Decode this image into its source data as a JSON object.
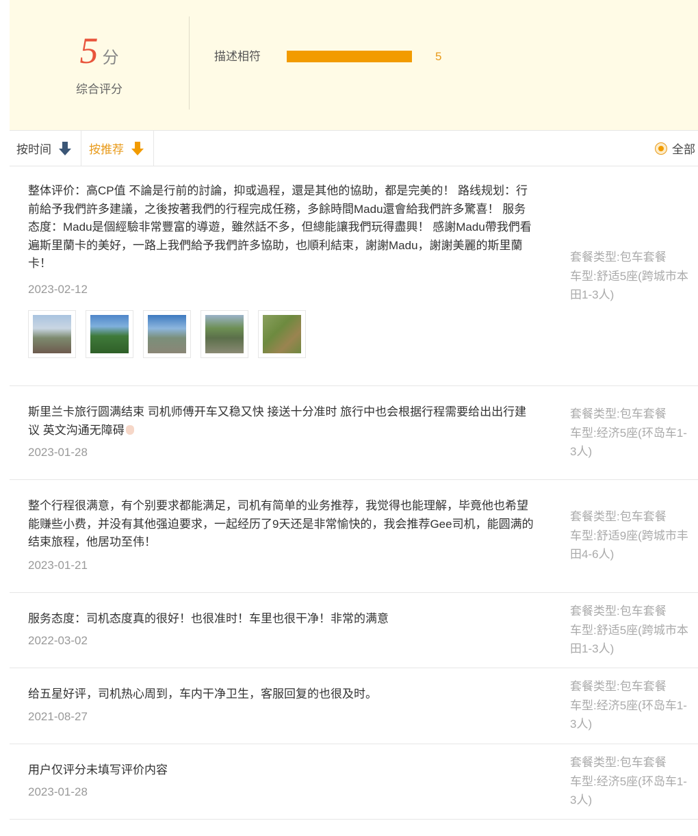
{
  "summary": {
    "score": "5",
    "score_unit": "分",
    "score_label": "综合评分",
    "metric": {
      "label": "描述相符",
      "value": "5",
      "fill_fraction": 1.0
    }
  },
  "sort": {
    "by_time": "按时间",
    "by_recommend": "按推荐",
    "filter_all": "全部",
    "active": "by_recommend"
  },
  "colors": {
    "accent": "#f29b00",
    "score": "#e8543c",
    "summary_bg": "#fffbe6",
    "arrow_dark": "#3b5676"
  },
  "reviews": [
    {
      "text": "整体评价：高CP值 不論是行前的討論，抑或過程，還是其他的協助，都是完美的！ 路线规划：行前給予我們許多建議，之後按著我們的行程完成任務，多餘時間Madu還會給我們許多驚喜！ 服务态度：Madu是個經驗非常豐富的導遊，雖然話不多，但總能讓我們玩得盡興！ 感謝Madu帶我們看遍斯里蘭卡的美好，一路上我們給予我們許多協助，也順利結束，謝謝Madu，謝謝美麗的斯里蘭卡！",
      "date": "2023-02-12",
      "meta_package": "套餐类型:包车套餐",
      "meta_car": "车型:舒适5座(跨城市本田1-3人)",
      "photos": [
        "photo-cliff-icon",
        "photo-trees-icon",
        "photo-valley-icon",
        "photo-rock-icon",
        "photo-grass-icon"
      ]
    },
    {
      "text": "斯里兰卡旅行圆满结束 司机师傅开车又稳又快 接送十分准时 旅行中也会根据行程需要给出出行建议 英文沟通无障碍",
      "date": "2023-01-28",
      "meta_package": "套餐类型:包车套餐",
      "meta_car": "车型:经济5座(环岛车1-3人)",
      "emoji": "ok-hand-emoji-icon"
    },
    {
      "text": "整个行程很满意，有个别要求都能满足，司机有简单的业务推荐，我觉得也能理解，毕竟他也希望能赚些小费，并没有其他强迫要求，一起经历了9天还是非常愉快的，我会推荐Gee司机，能圆满的结束旅程，他居功至伟！",
      "date": "2023-01-21",
      "meta_package": "套餐类型:包车套餐",
      "meta_car": "车型:舒适9座(跨城市丰田4-6人)"
    },
    {
      "text": "服务态度：司机态度真的很好！也很准时！车里也很干净！非常的满意",
      "date": "2022-03-02",
      "meta_package": "套餐类型:包车套餐",
      "meta_car": "车型:舒适5座(跨城市本田1-3人)"
    },
    {
      "text": "给五星好评，司机热心周到，车内干净卫生，客服回复的也很及时。",
      "date": "2021-08-27",
      "meta_package": "套餐类型:包车套餐",
      "meta_car": "车型:经济5座(环岛车1-3人)"
    },
    {
      "text": "用户仅评分未填写评价内容",
      "date": "2023-01-28",
      "meta_package": "套餐类型:包车套餐",
      "meta_car": "车型:经济5座(环岛车1-3人)"
    }
  ]
}
